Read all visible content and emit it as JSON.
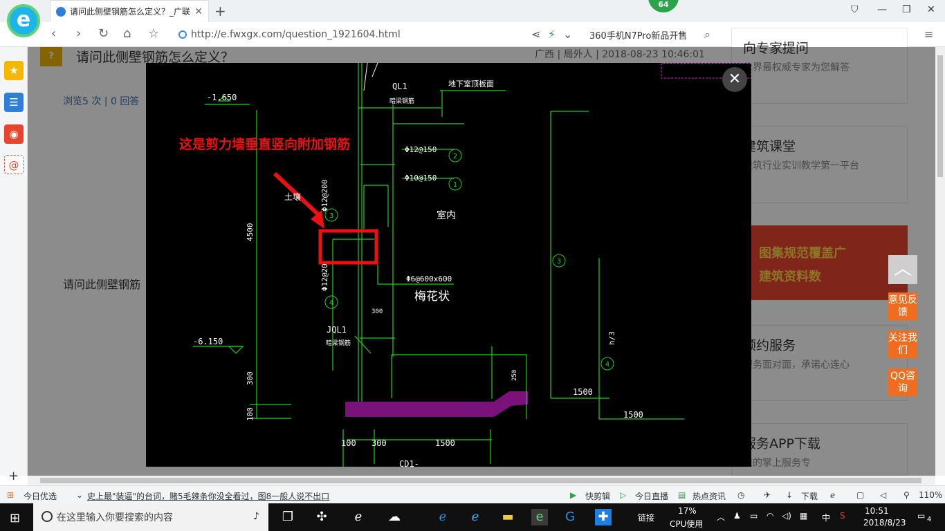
{
  "browser": {
    "tab_title": "请问此侧壁钢筋怎么定义？_广联",
    "tab_close": "✕",
    "new_tab": "+",
    "badge": "64",
    "url": "http://e.fwxgx.com/question_1921604.html",
    "search_hint": "360手机N7Pro新品开售"
  },
  "page": {
    "question_title": "请问此侧壁钢筋怎么定义？",
    "question_meta": "广西 | 局外人 | 2018-08-23 10:46:01",
    "stats": "浏览5 次 | 0 回答",
    "body_text": "请问此侧壁钢筋"
  },
  "cards": [
    {
      "title": "向专家提问",
      "desc": "业界最权威专家为您解答"
    },
    {
      "title": "建筑课堂",
      "desc": "建筑行业实训教学第一平台"
    },
    {
      "title": "预约服务",
      "desc": "服务面对面，承诺心连心"
    },
    {
      "title": "服务APP下载",
      "desc": "您的掌上服务专"
    }
  ],
  "banner": {
    "line1": "图集规范覆盖广",
    "line2": "建筑资料数"
  },
  "float_buttons": [
    "意见反馈",
    "关注我们",
    "QQ咨询"
  ],
  "drawing": {
    "annotation": "这是剪力墙垂直竖向附加钢筋",
    "labels": {
      "elev1": "-1.650",
      "elev2": "-6.150",
      "ql1": "QL1",
      "ql1_sub": "暗梁钢筋",
      "basement_top": "地下室顶板面",
      "rebar_12_150": "Φ12@150",
      "rebar_10_150": "Φ10@150",
      "rebar_12_200a": "Φ12@200",
      "rebar_12_200b": "Φ12@20",
      "indoor": "室内",
      "tie": "Φ6@600x600",
      "plum": "梅花状",
      "jql1": "JQL1",
      "jql1_sub": "暗梁钢筋",
      "dim_4500": "4500",
      "dim_300v": "300",
      "dim_100v": "100",
      "dim_300h": "300",
      "dim_100h": "100",
      "dim_1500a": "1500",
      "dim_1500b": "1500",
      "dim_1500c": "1500",
      "dim_250": "250",
      "dim_h3": "h/3",
      "dim_300w": "300",
      "c1": "1",
      "c2": "2",
      "c3a": "3",
      "c3b": "3",
      "c4a": "4",
      "c4b": "4",
      "bottom": "CD1-",
      "outside": "土壤"
    }
  },
  "statusbar": {
    "today": "今日优选",
    "news": "史上最\"装逼\"的台词，赌5毛辣条你没全看过，图8一般人说不出口",
    "kuaijian": "快剪辑",
    "live": "今日直播",
    "hot": "热点资讯",
    "download": "下载",
    "zoom": "110%"
  },
  "taskbar": {
    "search_placeholder": "在这里输入你要搜索的内容",
    "link": "链接",
    "cpu_pct": "17%",
    "cpu_label": "CPU使用",
    "ime": "中",
    "time": "10:51",
    "date": "2018/8/23",
    "notif": "4"
  }
}
